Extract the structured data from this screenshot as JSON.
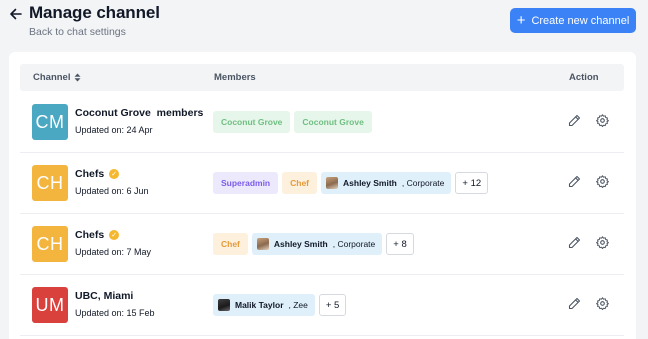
{
  "header": {
    "title": "Manage channel",
    "back_link": "Back to chat settings",
    "create_button": "Create new channel"
  },
  "table": {
    "columns": {
      "channel": "Channel",
      "members": "Members",
      "action": "Action"
    },
    "rows": [
      {
        "initials": "CM",
        "avatar_color": "#4ba8c3",
        "name": "Coconut Grove  members",
        "verified": false,
        "updated": "Updated on: 24 Apr",
        "tags": [
          "Coconut Grove",
          "Coconut Grove"
        ]
      },
      {
        "initials": "CH",
        "avatar_color": "#f3b53e",
        "name": "Chefs",
        "verified": true,
        "updated": "Updated on: 6 Jun",
        "tags": [
          "Superadmin",
          "Chef"
        ],
        "person": {
          "name": "Ashley Smith",
          "role": ", Corporate"
        },
        "more": "+ 12"
      },
      {
        "initials": "CH",
        "avatar_color": "#f3b53e",
        "name": "Chefs",
        "verified": true,
        "updated": "Updated on: 7 May",
        "tags": [
          "Chef"
        ],
        "person": {
          "name": "Ashley Smith",
          "role": ", Corporate"
        },
        "more": "+ 8"
      },
      {
        "initials": "UM",
        "avatar_color": "#d9413d",
        "name": "UBC, Miami",
        "verified": false,
        "updated": "Updated on: 15 Feb",
        "person": {
          "name": "Malik Taylor",
          "role": ", Zee"
        },
        "more": "+ 5"
      }
    ]
  },
  "colors": {
    "primary": "#3b82f6",
    "tag_green_bg": "#e7f6ea",
    "tag_purple_bg": "#ece9fd",
    "tag_orange_bg": "#fdf0dd",
    "tag_person_bg": "#dff0fb"
  },
  "icons": {
    "back": "arrow-left-icon",
    "create": "plus-icon",
    "sort": "sort-icon",
    "verified": "verified-badge-icon",
    "edit": "pencil-icon",
    "settings": "gear-icon"
  }
}
